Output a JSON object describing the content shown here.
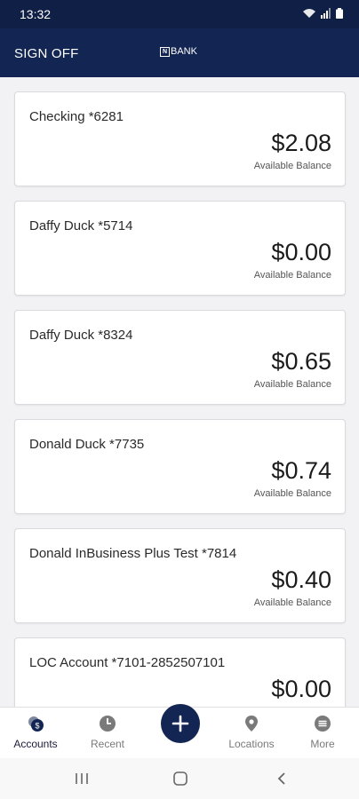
{
  "status_bar": {
    "time": "13:32"
  },
  "header": {
    "sign_off_label": "SIGN OFF",
    "logo_text": "BANK",
    "logo_mark": "N",
    "background": "#132552"
  },
  "accounts": [
    {
      "name": "Checking *6281",
      "amount": "$2.08",
      "label": "Available Balance"
    },
    {
      "name": "Daffy Duck *5714",
      "amount": "$0.00",
      "label": "Available Balance"
    },
    {
      "name": "Daffy Duck *8324",
      "amount": "$0.65",
      "label": "Available Balance"
    },
    {
      "name": "Donald Duck *7735",
      "amount": "$0.74",
      "label": "Available Balance"
    },
    {
      "name": "Donald InBusiness Plus Test *7814",
      "amount": "$0.40",
      "label": "Available Balance"
    },
    {
      "name": "LOC Account *7101-2852507101",
      "amount": "$0.00",
      "label": ""
    }
  ],
  "bottom_nav": {
    "items": [
      {
        "label": "Accounts",
        "icon": "accounts-dollar-icon",
        "active": true
      },
      {
        "label": "Recent",
        "icon": "clock-icon",
        "active": false
      },
      {
        "label": "",
        "icon": "plus-icon",
        "active": false
      },
      {
        "label": "Locations",
        "icon": "location-pin-icon",
        "active": false
      },
      {
        "label": "More",
        "icon": "more-menu-icon",
        "active": false
      }
    ]
  },
  "system_nav": {
    "icons": [
      "recent-apps-icon",
      "home-icon",
      "back-icon"
    ]
  }
}
